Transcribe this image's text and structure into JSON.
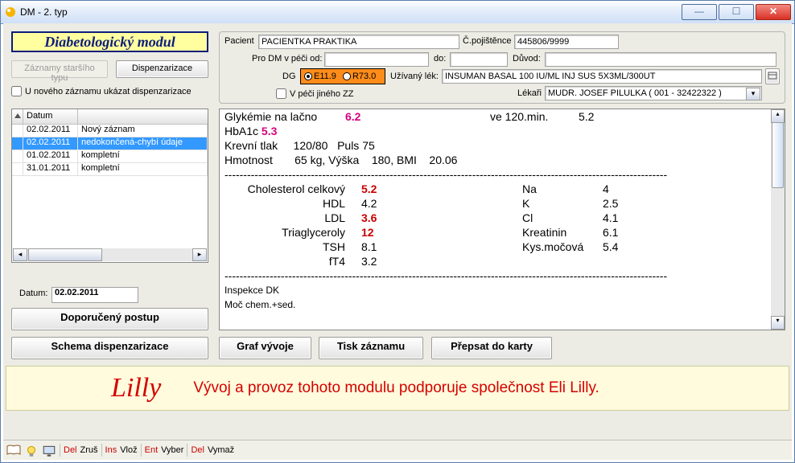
{
  "window": {
    "title": "DM - 2. typ"
  },
  "module_title": "Diabetologický modul",
  "buttons": {
    "old_records": "Záznamy staršího typu",
    "dispenzarizace": "Dispenzarizace",
    "postup": "Doporučený postup",
    "schema": "Schema dispenzarizace",
    "graf": "Graf vývoje",
    "tisk": "Tisk záznamu",
    "prepsat": "Přepsat do karty"
  },
  "checks": {
    "new_rec": "U nového záznamu ukázat dispenzarizace",
    "v_peci": "V péči jiného ZZ"
  },
  "patient": {
    "lbl_pacient": "Pacient",
    "pacient": "PACIENTKA PRAKTIKA",
    "lbl_cpoj": "Č.pojištěnce",
    "cpoj": "445806/9999",
    "lbl_pro": "Pro DM v péči od:",
    "od": "",
    "lbl_do": "do:",
    "do": "",
    "lbl_duvod": "Důvod:",
    "duvod": "",
    "lbl_dg": "DG",
    "dg1": "E11.9",
    "dg2": "R73.0",
    "lbl_lek": "Užívaný lék:",
    "lek": "INSUMAN BASAL 100 IU/ML INJ SUS 5X3ML/300UT",
    "lbl_lekari": "Lékaři",
    "lekari": "MUDR. JOSEF PILULKA ( 001 - 32422322 )"
  },
  "grid": {
    "h1": "Datum",
    "rows": [
      {
        "d": "02.02.2011",
        "s": "Nový záznam"
      },
      {
        "d": "02.02.2011",
        "s": "nedokončená-chybí údaje"
      },
      {
        "d": "01.02.2011",
        "s": "kompletní"
      },
      {
        "d": "31.01.2011",
        "s": "kompletní"
      }
    ],
    "selected": 1
  },
  "date": {
    "lbl": "Datum:",
    "val": "02.02.2011"
  },
  "report": {
    "l1_a": "Glykémie na lačno",
    "l1_v": "6.2",
    "l1_b": "ve 120.min.",
    "l1_b_v": "5.2",
    "l2_a": "HbA1c",
    "l2_v": "5.3",
    "l3": "Krevní tlak     120/80   Puls 75",
    "l4": "Hmotnost       65 kg, Výška    180, BMI    20.06",
    "dash": "----------------------------------------------------------------------------------------------------------------------",
    "labs_left": [
      {
        "n": "Cholesterol celkový",
        "v": "5.2",
        "red": true
      },
      {
        "n": "HDL",
        "v": "4.2",
        "red": false
      },
      {
        "n": "LDL",
        "v": "3.6",
        "red": true
      },
      {
        "n": "Triaglyceroly",
        "v": "12",
        "red": true
      },
      {
        "n": "TSH",
        "v": "8.1",
        "red": false
      },
      {
        "n": "fT4",
        "v": "3.2",
        "red": false
      }
    ],
    "labs_right": [
      {
        "n": "Na",
        "v": "4"
      },
      {
        "n": "K",
        "v": "2.5"
      },
      {
        "n": "Cl",
        "v": "4.1"
      },
      {
        "n": "Kreatinin",
        "v": "6.1"
      },
      {
        "n": "Kys.močová",
        "v": "5.4"
      }
    ],
    "foot1": "Inspekce DK",
    "foot2": "Moč chem.+sed."
  },
  "sponsor": {
    "logo": "Lilly",
    "text": "Vývoj a provoz tohoto modulu podporuje společnost Eli Lilly."
  },
  "status": {
    "del": "Del",
    "zrus": "Zruš",
    "ins": "Ins",
    "vloz": "Vlož",
    "ent": "Ent",
    "vyber": "Vyber",
    "del2": "Del",
    "vymaz": "Vymaž"
  }
}
